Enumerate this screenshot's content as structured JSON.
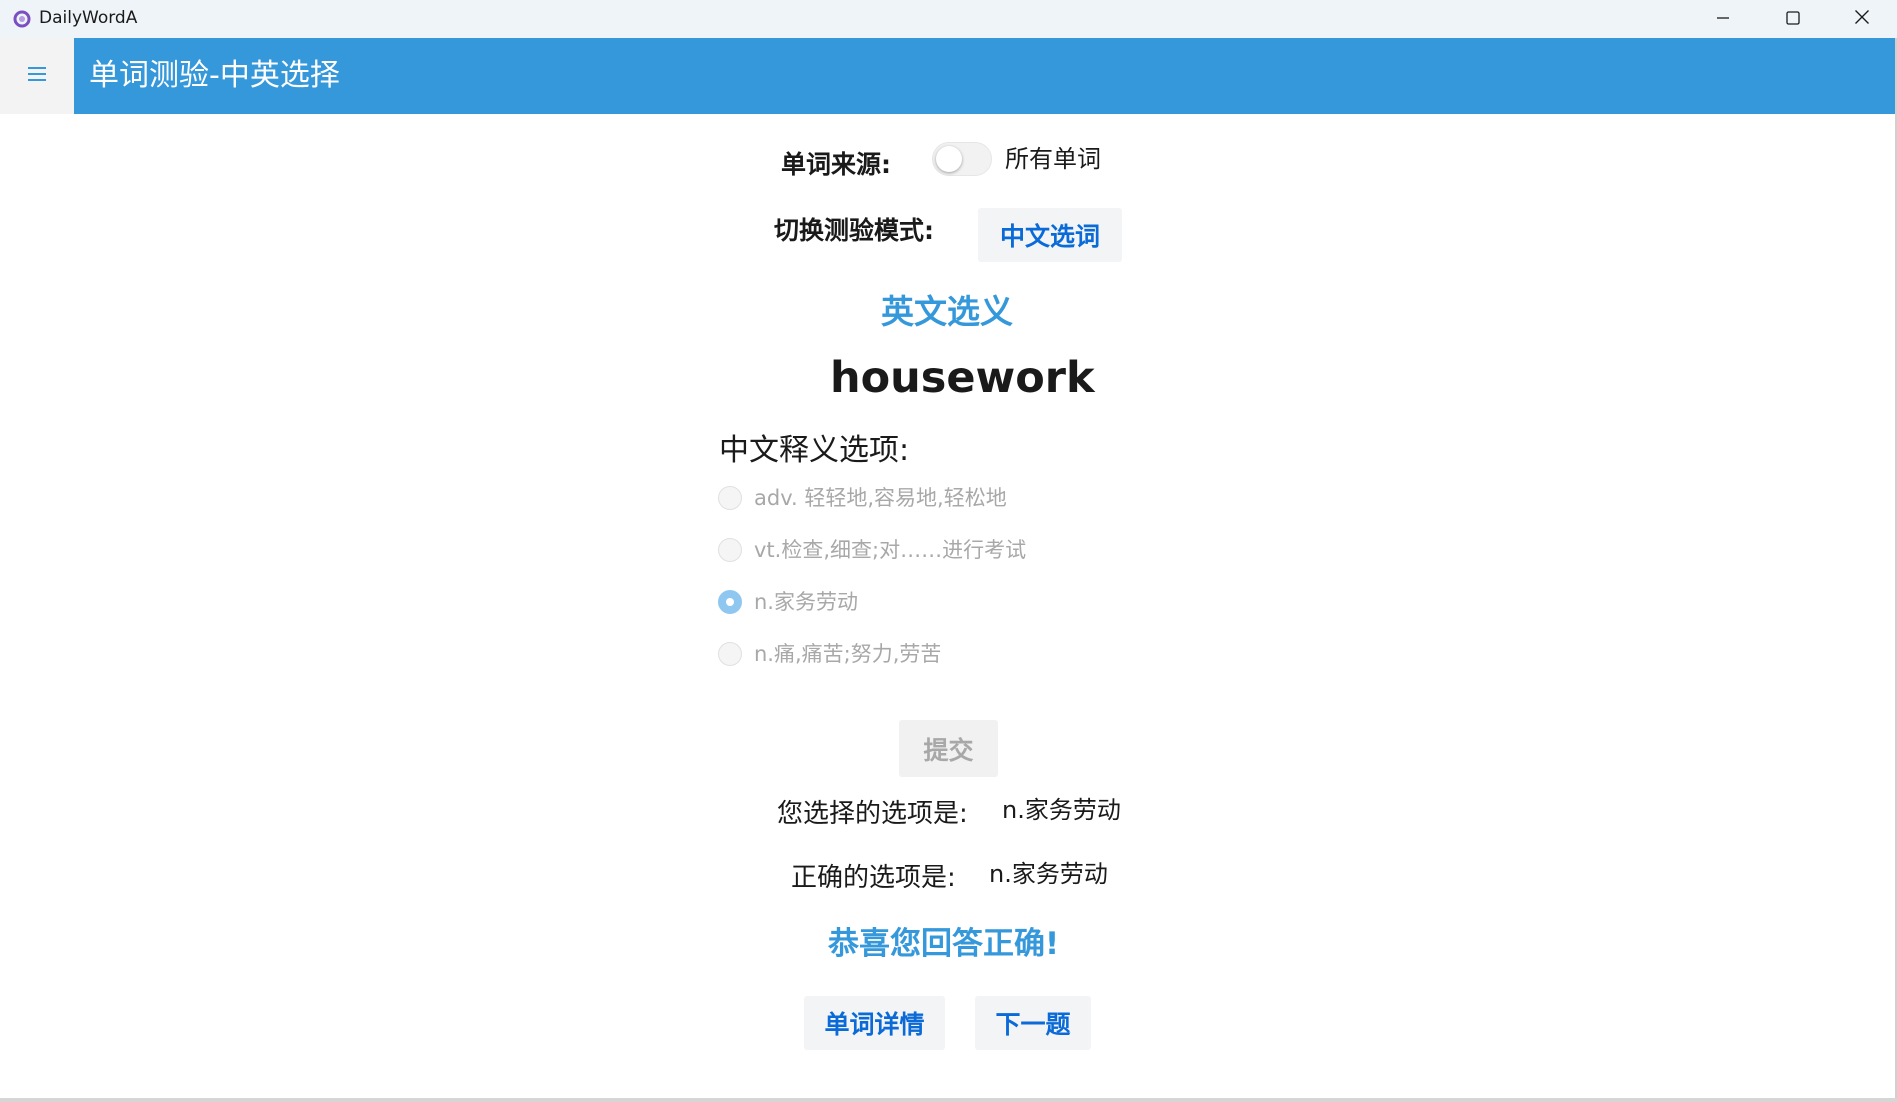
{
  "window": {
    "app_title": "DailyWordA"
  },
  "header": {
    "title": "单词测验-中英选择"
  },
  "source": {
    "label": "单词来源:",
    "toggle_label": "所有单词",
    "toggle_on": false
  },
  "mode": {
    "label": "切换测验模式:",
    "button_label": "中文选词",
    "current_mode_title": "英文选义"
  },
  "quiz": {
    "word": "housework",
    "options_label": "中文释义选项:",
    "options": [
      {
        "text": "adv. 轻轻地,容易地,轻松地",
        "checked": false
      },
      {
        "text": "vt.检查,细查;对……进行考试",
        "checked": false
      },
      {
        "text": "n.家务劳动",
        "checked": true
      },
      {
        "text": "n.痛,痛苦;努力,劳苦",
        "checked": false
      }
    ],
    "submit_label": "提交"
  },
  "result": {
    "selected_label": "您选择的选项是:",
    "selected_value": "n.家务劳动",
    "correct_label": "正确的选项是:",
    "correct_value": "n.家务劳动",
    "message": "恭喜您回答正确!"
  },
  "actions": {
    "details_label": "单词详情",
    "next_label": "下一题"
  },
  "colors": {
    "header_bg": "#3598db",
    "accent_text": "#3598db",
    "button_text": "#0a6ad8",
    "disabled_text": "#a8a8a8"
  }
}
